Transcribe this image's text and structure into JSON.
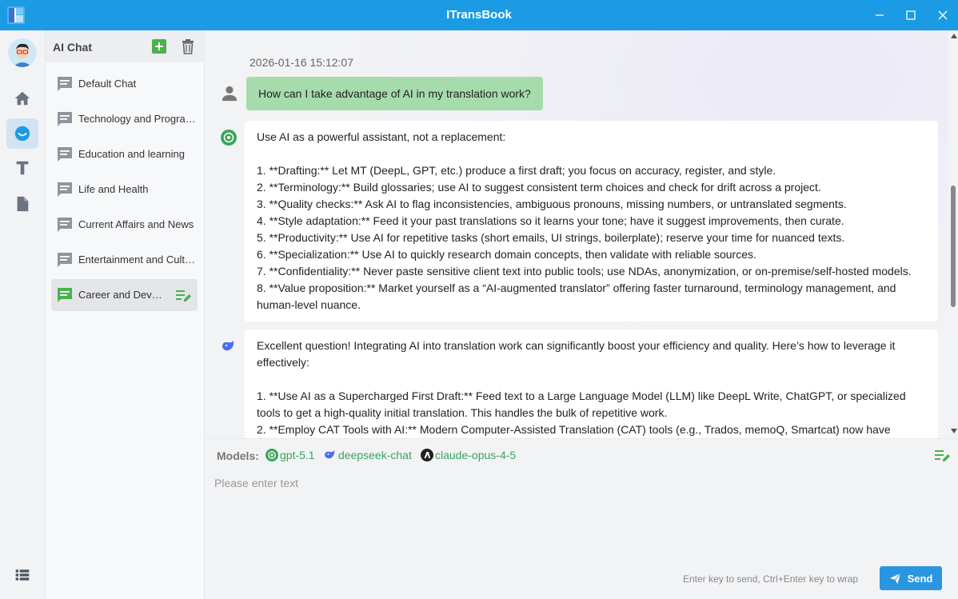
{
  "window": {
    "title": "ITransBook"
  },
  "sidebar": {
    "title": "AI Chat",
    "chats": [
      {
        "label": "Default Chat"
      },
      {
        "label": "Technology and Programming"
      },
      {
        "label": "Education and learning"
      },
      {
        "label": "Life and Health"
      },
      {
        "label": "Current Affairs and News"
      },
      {
        "label": "Entertainment and Culture"
      },
      {
        "label": "Career and Development"
      }
    ],
    "active_index": 6
  },
  "conversation": {
    "timestamp": "2026-01-16 15:12:07",
    "user_message": "How can I take advantage of AI in my translation work?",
    "responses": [
      {
        "model": "gpt-5.1",
        "intro": "Use AI as a powerful assistant, not a replacement:",
        "items": [
          "1. **Drafting:** Let MT (DeepL, GPT, etc.) produce a first draft; you focus on accuracy, register, and style.",
          "2. **Terminology:** Build glossaries; use AI to suggest consistent term choices and check for drift across a project.",
          "3. **Quality checks:** Ask AI to flag inconsistencies, ambiguous pronouns, missing numbers, or untranslated segments.",
          "4. **Style adaptation:** Feed it your past translations so it learns your tone; have it suggest improvements, then curate.",
          "5. **Productivity:** Use AI for repetitive tasks (short emails, UI strings, boilerplate); reserve your time for nuanced texts.",
          "6. **Specialization:** Use AI to quickly research domain concepts, then validate with reliable sources.",
          "7. **Confidentiality:** Never paste sensitive client text into public tools; use NDAs, anonymization, or on-premise/self-hosted models.",
          "8. **Value proposition:** Market yourself as a “AI-augmented translator” offering faster turnaround, terminology management, and human-level nuance."
        ]
      },
      {
        "model": "deepseek-chat",
        "intro": "Excellent question! Integrating AI into translation work can significantly boost your efficiency and quality. Here’s how to leverage it effectively:",
        "items": [
          "1.  **Use AI as a Supercharged First Draft:** Feed text to a Large Language Model (LLM) like DeepL Write, ChatGPT, or specialized tools to get a high-quality initial translation. This handles the bulk of repetitive work.",
          "2.  **Employ CAT Tools with AI:** Modern Computer-Assisted Translation (CAT) tools (e.g., Trados, memoQ, Smartcat) now have"
        ]
      }
    ]
  },
  "models_bar": {
    "label": "Models:",
    "models": [
      "gpt-5.1",
      "deepseek-chat",
      "claude-opus-4-5"
    ]
  },
  "composer": {
    "placeholder": "Please enter text",
    "hint": "Enter key to send, Ctrl+Enter key to wrap",
    "send_label": "Send"
  },
  "colors": {
    "titlebar": "#1b9be3",
    "user_bubble": "#a6dbab",
    "model_text": "#3aa55c",
    "send_button": "#2b96e0",
    "accent_green": "#4caf50"
  },
  "icons": {
    "rail": [
      "home-icon",
      "chat-icon",
      "text-icon",
      "document-icon",
      "list-icon"
    ]
  }
}
